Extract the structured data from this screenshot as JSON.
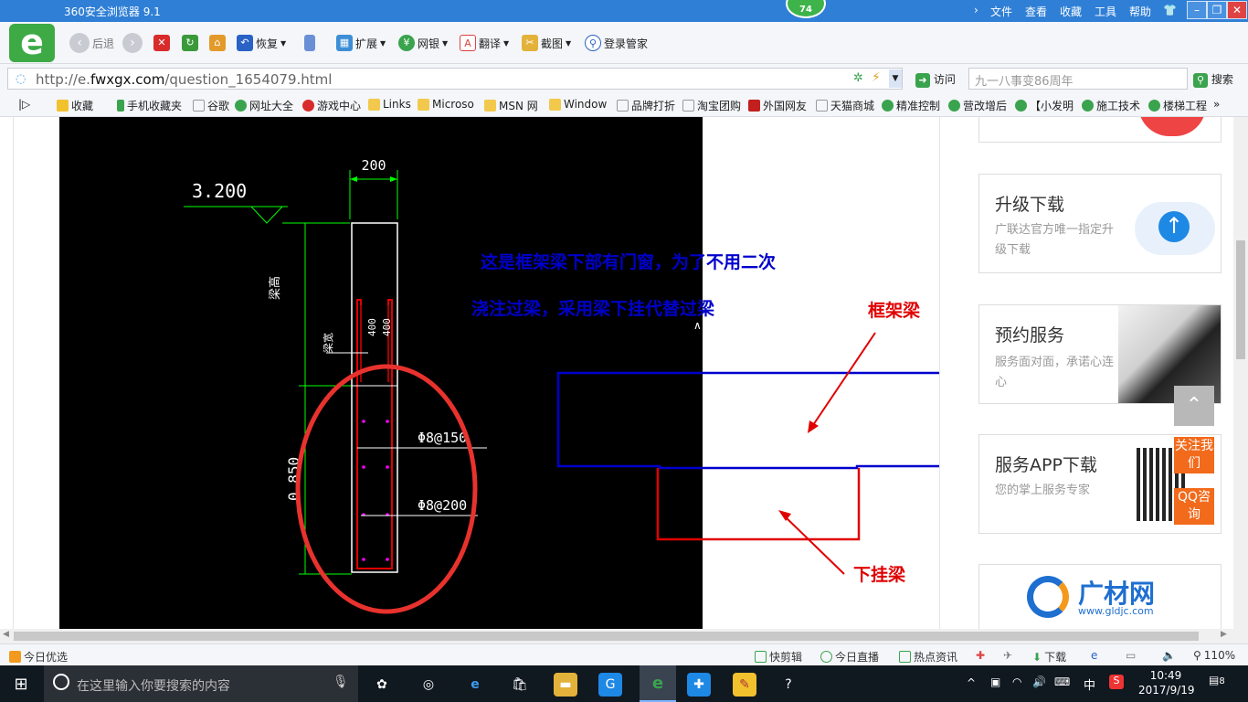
{
  "browser": {
    "title": "360安全浏览器 9.1",
    "badge": "74",
    "menu": [
      "文件",
      "查看",
      "收藏",
      "工具",
      "帮助"
    ],
    "toolbar": {
      "back": "后退",
      "restore": "恢复",
      "extend": "扩展",
      "bank": "网银",
      "translate": "翻译",
      "screenshot": "截图",
      "login": "登录管家"
    },
    "address": {
      "url_prefix": "http://e.",
      "url_domain": "fwxgx.com",
      "url_path": "/question_1654079.html",
      "visit": "访问",
      "search_placeholder": "九一八事变86周年",
      "search_button": "搜索"
    },
    "favorites": [
      "收藏",
      "手机收藏夹",
      "谷歌",
      "网址大全",
      "游戏中心",
      "Links",
      "Microso",
      "MSN 网",
      "Window",
      "品牌打折",
      "淘宝团购",
      "外国网友",
      "天猫商城",
      "精准控制",
      "营改增后",
      "【小发明",
      "施工技术",
      "楼梯工程"
    ],
    "favorites_more": "»"
  },
  "drawing": {
    "dim_top": "200",
    "elevation": "3.200",
    "label_beam_height": "梁高",
    "label_400a": "400",
    "label_400b": "400",
    "label_beam": "梁宽",
    "rebar1": "Φ8@150",
    "rebar2": "Φ8@200",
    "dim_left": "0.850",
    "note_line1": "这是框架梁下部有门窗，为了不用二次",
    "note_line2": "浇注过梁，采用梁下挂代替过梁",
    "label_frame_beam": "框架梁",
    "label_hanging_beam": "下挂梁",
    "colors": {
      "blue": "#0000cc",
      "red": "#e00000",
      "circle": "#e8322d",
      "cad_green": "#00ff00"
    }
  },
  "sidebar": {
    "cards": [
      {
        "title": "升级下载",
        "desc": "广联达官方唯一指定升级下载"
      },
      {
        "title": "预约服务",
        "desc": "服务面对面，承诺心连心"
      },
      {
        "title": "服务APP下载",
        "desc": "您的掌上服务专家"
      }
    ],
    "follow": "关注我们",
    "qq": "QQ咨询",
    "brand": "广材网",
    "brand_url": "www.gldjc.com"
  },
  "status": {
    "today": "今日优选",
    "clip": "快剪辑",
    "live": "今日直播",
    "news": "热点资讯",
    "download": "下载",
    "zoom": "110%"
  },
  "taskbar": {
    "search_placeholder": "在这里输入你要搜索的内容",
    "ime": "中",
    "time": "10:49",
    "date": "2017/9/19",
    "notif": "8"
  }
}
